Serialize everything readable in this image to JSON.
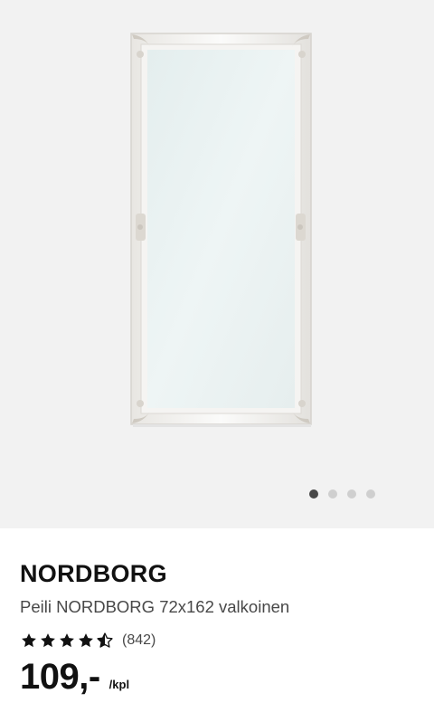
{
  "gallery": {
    "image_icon": "mirror-product-image",
    "dots": [
      {
        "active": true
      },
      {
        "active": false
      },
      {
        "active": false
      },
      {
        "active": false
      }
    ],
    "colors": {
      "background": "#f2f2f2",
      "dot_active": "#484848",
      "dot_inactive": "#cfcfcf"
    }
  },
  "product": {
    "name": "NORDBORG",
    "description": "Peili NORDBORG 72x162 valkoinen",
    "rating": {
      "stars": 4.5,
      "max_stars": 5,
      "review_count": "(842)"
    },
    "price": "109,-",
    "unit": "/kpl"
  }
}
